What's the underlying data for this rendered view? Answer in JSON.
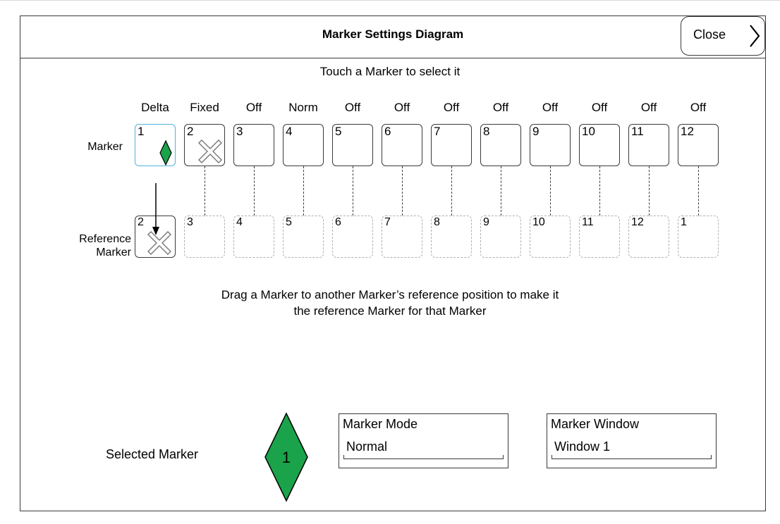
{
  "header": {
    "title": "Marker Settings Diagram",
    "close_label": "Close"
  },
  "instructions": {
    "select": "Touch a Marker to select it",
    "drag_line1": "Drag a Marker to another Marker’s reference position to make it",
    "drag_line2": "the reference Marker for that Marker"
  },
  "rows": {
    "marker_label": "Marker",
    "reference_label_line1": "Reference",
    "reference_label_line2": "Marker"
  },
  "markers": [
    {
      "number": "1",
      "state": "Delta",
      "reference": "2",
      "selected": true
    },
    {
      "number": "2",
      "state": "Fixed",
      "reference": "3"
    },
    {
      "number": "3",
      "state": "Off",
      "reference": "4"
    },
    {
      "number": "4",
      "state": "Norm",
      "reference": "5"
    },
    {
      "number": "5",
      "state": "Off",
      "reference": "6"
    },
    {
      "number": "6",
      "state": "Off",
      "reference": "7"
    },
    {
      "number": "7",
      "state": "Off",
      "reference": "8"
    },
    {
      "number": "8",
      "state": "Off",
      "reference": "9"
    },
    {
      "number": "9",
      "state": "Off",
      "reference": "10"
    },
    {
      "number": "10",
      "state": "Off",
      "reference": "11"
    },
    {
      "number": "11",
      "state": "Off",
      "reference": "12"
    },
    {
      "number": "12",
      "state": "Off",
      "reference": "1"
    }
  ],
  "selected": {
    "label": "Selected Marker",
    "number": "1",
    "color": "#1aa34a",
    "mode_label": "Marker Mode",
    "mode_value": "Normal",
    "window_label": "Marker Window",
    "window_value": "Window 1"
  },
  "icons": {
    "selected_marker": "green-diamond-icon",
    "fixed_marker": "x-mark-icon",
    "close": "chevron-right-icon"
  }
}
